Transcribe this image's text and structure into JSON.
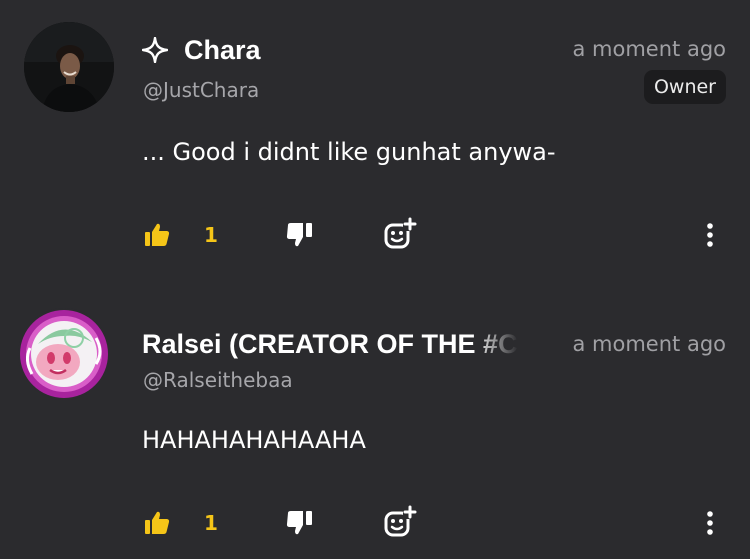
{
  "comments": [
    {
      "author": "Chara",
      "handle": "@JustChara",
      "timestamp": "a moment ago",
      "badge": "Owner",
      "text": "... Good i didnt like gunhat anywa-",
      "likes": "1"
    },
    {
      "author": "Ralsei (CREATOR OF THE #C",
      "handle": "@Ralseithebaa",
      "timestamp": "a moment ago",
      "text": "HAHAHAHAHAAHA",
      "likes": "1"
    }
  ],
  "colors": {
    "background": "#2b2b2e",
    "like_accent": "#f5c518",
    "secondary_text": "#a0a0a4",
    "badge_background": "#1c1c1e"
  },
  "icons": {
    "author_marker": "sparkle-star-icon",
    "like": "thumbs-up-icon",
    "dislike": "thumbs-down-icon",
    "reply": "add-emoji-reply-icon",
    "more": "vertical-dots-icon"
  }
}
